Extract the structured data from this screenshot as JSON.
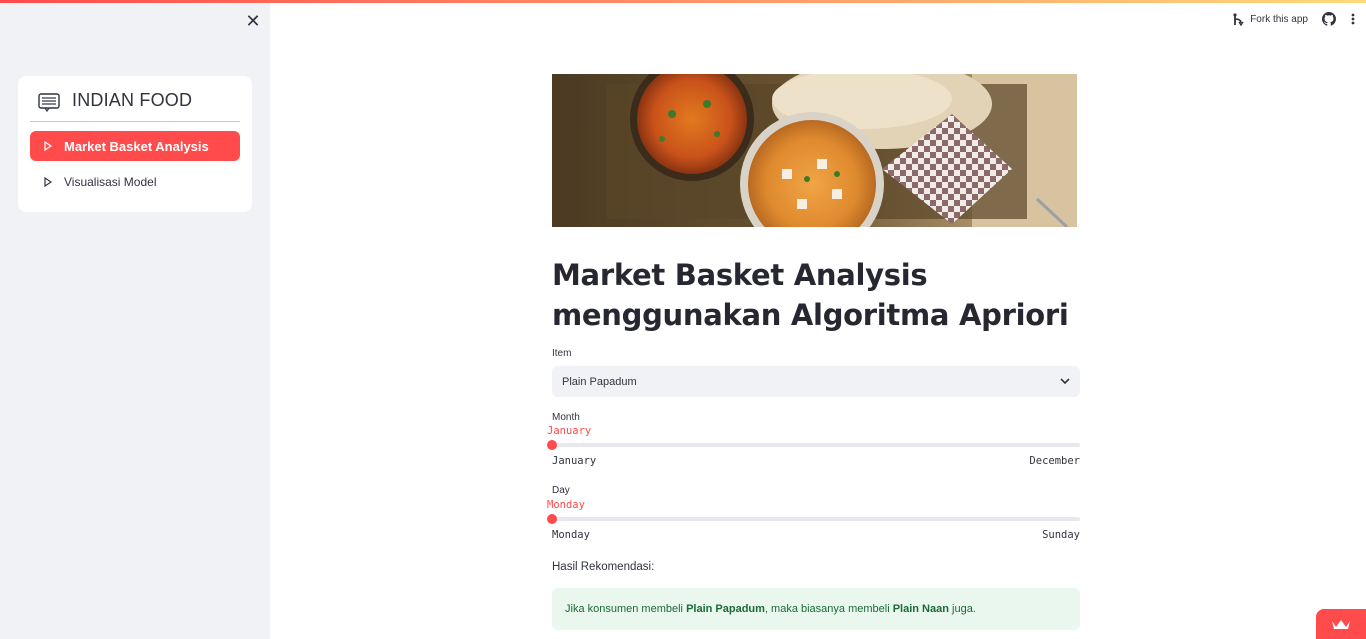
{
  "sidebar": {
    "close_icon": "close-icon",
    "menu_title": "INDIAN FOOD",
    "menu_icon": "card-list-icon",
    "items": [
      {
        "label": "Market Basket Analysis",
        "icon": "play-outline-icon",
        "active": true
      },
      {
        "label": "Visualisasi Model",
        "icon": "play-outline-icon",
        "active": false
      }
    ]
  },
  "toolbar": {
    "fork_label": "Fork this app",
    "fork_icon": "fork-icon",
    "github_icon": "github-icon",
    "menu_icon": "vertical-ellipsis-icon"
  },
  "main": {
    "title_line1": "Market Basket Analysis",
    "title_line2": "menggunakan Algoritma Apriori",
    "item": {
      "label": "Item",
      "value": "Plain Papadum"
    },
    "month": {
      "label": "Month",
      "value": "January",
      "min": "January",
      "max": "December",
      "position": 0
    },
    "day": {
      "label": "Day",
      "value": "Monday",
      "min": "Monday",
      "max": "Sunday",
      "position": 0
    },
    "result_label": "Hasil Rekomendasi:",
    "result": {
      "prefix": "Jika konsumen membeli ",
      "item_a": "Plain Papadum",
      "middle": ", maka biasanya membeli ",
      "item_b": "Plain Naan",
      "suffix": " juga."
    }
  },
  "colors": {
    "accent": "#ff4b4b",
    "sidebar_bg": "#f0f2f6",
    "success_bg": "#e9f7ee",
    "success_text": "#1a6b37"
  }
}
